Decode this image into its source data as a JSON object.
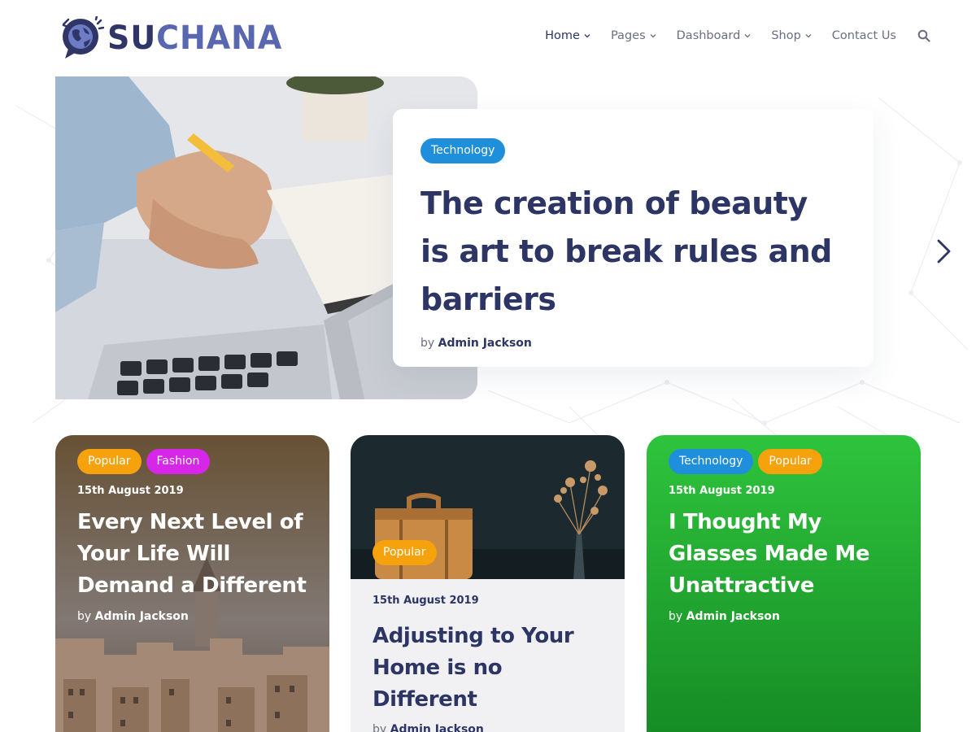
{
  "brand": {
    "name_part1": "SU",
    "name_part2": "CHANA",
    "logo_icon": "globe-chat-icon"
  },
  "nav": {
    "items": [
      {
        "label": "Home",
        "dropdown": true
      },
      {
        "label": "Pages",
        "dropdown": true
      },
      {
        "label": "Dashboard",
        "dropdown": true
      },
      {
        "label": "Shop",
        "dropdown": true
      },
      {
        "label": "Contact Us",
        "dropdown": false
      }
    ],
    "search_icon": "search-icon"
  },
  "hero": {
    "category": "Technology",
    "title": "The creation of beauty is art to break rules and barriers",
    "by_prefix": "by",
    "author": "Admin Jackson",
    "next_icon": "chevron-right-icon"
  },
  "cards": [
    {
      "tags": [
        "Popular",
        "Fashion"
      ],
      "date": "15th August 2019",
      "title": "Every Next Level of Your Life Will Demand a Different",
      "by_prefix": "by",
      "author": "Admin Jackson"
    },
    {
      "tags": [
        "Popular"
      ],
      "date": "15th August 2019",
      "title": "Adjusting to Your Home is no Different",
      "by_prefix": "by",
      "author": "Admin Jackson"
    },
    {
      "tags": [
        "Technology",
        "Popular"
      ],
      "date": "15th August 2019",
      "title": "I Thought My Glasses Made Me Unattractive",
      "by_prefix": "by",
      "author": "Admin Jackson"
    }
  ],
  "colors": {
    "primary_text": "#2c3564",
    "tag_technology": "#1f8fdc",
    "tag_popular": "#f6a20c",
    "tag_fashion": "#d626e8",
    "green_card": "#2fc43d"
  }
}
